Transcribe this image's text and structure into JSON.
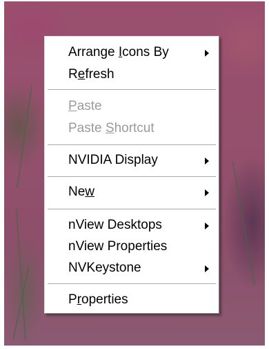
{
  "menu": {
    "items": [
      {
        "pre": "Arrange ",
        "key": "I",
        "post": "cons By",
        "disabled": false,
        "submenu": true
      },
      {
        "pre": "R",
        "key": "e",
        "post": "fresh",
        "disabled": false,
        "submenu": false
      },
      {
        "pre": "",
        "key": "P",
        "post": "aste",
        "disabled": true,
        "submenu": false
      },
      {
        "pre": "Paste ",
        "key": "S",
        "post": "hortcut",
        "disabled": true,
        "submenu": false
      },
      {
        "pre": "NVIDIA Display",
        "key": "",
        "post": "",
        "disabled": false,
        "submenu": true
      },
      {
        "pre": "Ne",
        "key": "w",
        "post": "",
        "disabled": false,
        "submenu": true
      },
      {
        "pre": "nView Desktops",
        "key": "",
        "post": "",
        "disabled": false,
        "submenu": true
      },
      {
        "pre": "nView Properties",
        "key": "",
        "post": "",
        "disabled": false,
        "submenu": false
      },
      {
        "pre": "NVKeystone",
        "key": "",
        "post": "",
        "disabled": false,
        "submenu": true
      },
      {
        "pre": "P",
        "key": "r",
        "post": "operties",
        "disabled": false,
        "submenu": false
      }
    ]
  }
}
